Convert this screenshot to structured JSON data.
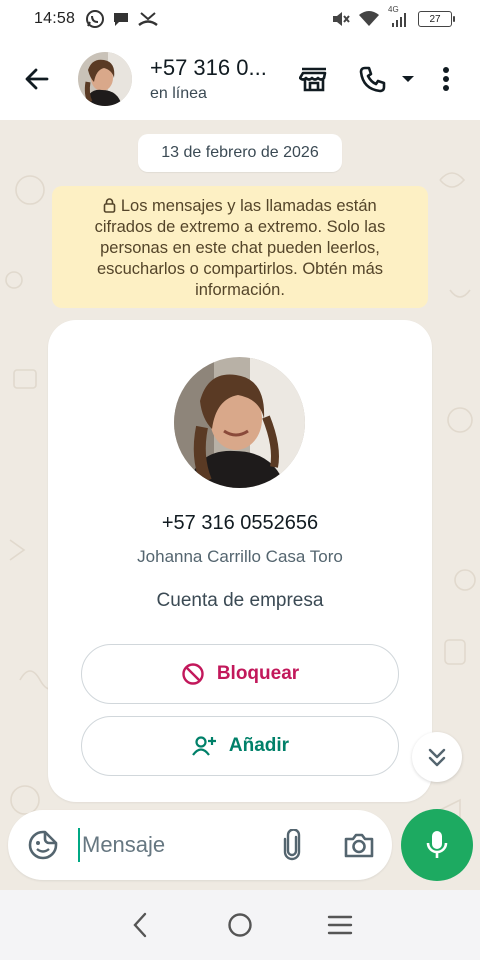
{
  "status_bar": {
    "time": "14:58",
    "network": "4G",
    "battery_level": "27",
    "icons_left": [
      "whatsapp-icon",
      "chat-bubble-icon",
      "missed-call-icon"
    ],
    "icons_right": [
      "mute-icon",
      "wifi-icon",
      "signal-icon",
      "battery-icon"
    ]
  },
  "header": {
    "contact_name": "+57 316 0...",
    "contact_status": "en línea",
    "actions": [
      "store-icon",
      "phone-icon",
      "dropdown-icon",
      "more-vert-icon"
    ]
  },
  "chat": {
    "date_chip": "13 de febrero de 2026",
    "encryption_notice": "Los mensajes y las llamadas están cifrados de extremo a extremo. Solo las personas en este chat pueden leerlos, escucharlos o compartirlos. Obtén más información."
  },
  "business_card": {
    "phone": "+57 316 0552656",
    "name": "Johanna Carrillo Casa Toro",
    "account_type": "Cuenta de empresa",
    "block_label": "Bloquear",
    "add_label": "Añadir"
  },
  "input_bar": {
    "placeholder": "Mensaje"
  },
  "colors": {
    "accent_green": "#1daa61",
    "block_red": "#c2185b",
    "add_green": "#008069",
    "chat_bg": "#efeae2",
    "notice_bg": "#fdf0c4"
  }
}
